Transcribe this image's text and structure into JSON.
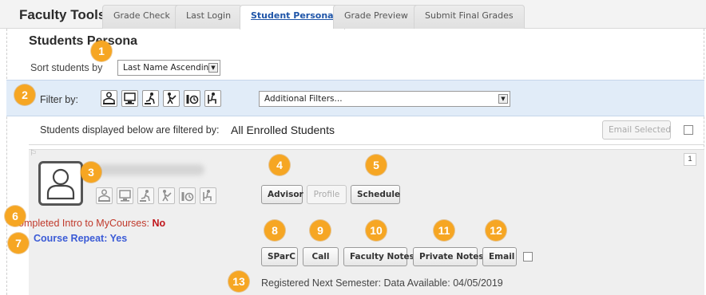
{
  "header": {
    "title": "Faculty Tools",
    "tabs": [
      {
        "label": "Grade Check",
        "active": false
      },
      {
        "label": "Last Login",
        "active": false
      },
      {
        "label": "Student Persona",
        "active": true
      },
      {
        "label": "Grade Preview",
        "active": false
      },
      {
        "label": "Submit Final Grades",
        "active": false
      }
    ]
  },
  "section": {
    "title": "Students Persona",
    "sort_label": "Sort students by",
    "sort_value": "Last Name Ascending"
  },
  "filter": {
    "label": "Filter by:",
    "icons": [
      "advisor-filter-icon",
      "computer-filter-icon",
      "reading-filter-icon",
      "walking-filter-icon",
      "timer-filter-icon",
      "seated-filter-icon"
    ],
    "additional_placeholder": "Additional Filters..."
  },
  "display": {
    "label": "Students displayed below are filtered by:",
    "value": "All Enrolled Students",
    "email_selected": "Email Selected"
  },
  "student": {
    "row_number": "1",
    "buttons_top": {
      "advisor": "Advisor",
      "profile": "Profile",
      "schedule": "Schedule"
    },
    "buttons_bottom": {
      "sparc": "SParC",
      "call": "Call",
      "faculty_notes": "Faculty Notes",
      "private_notes": "Private Notes",
      "email": "Email"
    },
    "intro_label": "Completed Intro to MyCourses:",
    "intro_value": "No",
    "repeat_text": "Course Repeat: Yes",
    "registered_text": "Registered Next Semester: Data Available:",
    "registered_date": "04/05/2019"
  },
  "callouts": [
    "1",
    "2",
    "3",
    "4",
    "5",
    "6",
    "7",
    "8",
    "9",
    "10",
    "11",
    "12",
    "13"
  ],
  "colors": {
    "accent": "#1f55a8",
    "callout": "#f6a623",
    "filter_band": "#e1ecf8",
    "warn_red": "#c0161c",
    "repeat_blue": "#3b5bd6"
  }
}
